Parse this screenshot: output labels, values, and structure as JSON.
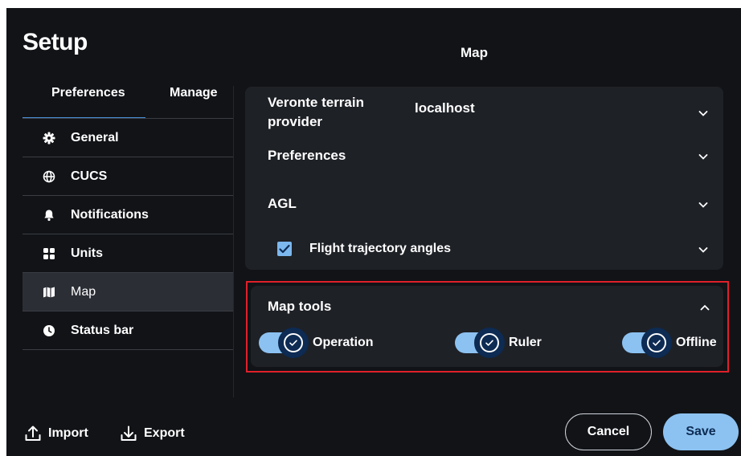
{
  "dialog": {
    "title": "Setup",
    "section_title": "Map"
  },
  "tabs": [
    {
      "label": "Preferences",
      "active": true
    },
    {
      "label": "Manage",
      "active": false
    }
  ],
  "menu": [
    {
      "label": "General",
      "icon": "gear-icon"
    },
    {
      "label": "CUCS",
      "icon": "globe-icon"
    },
    {
      "label": "Notifications",
      "icon": "bell-icon"
    },
    {
      "label": "Units",
      "icon": "grid-icon"
    },
    {
      "label": "Map",
      "icon": "map-icon",
      "active": true
    },
    {
      "label": "Status bar",
      "icon": "clock-icon"
    }
  ],
  "settings": {
    "terrain_provider_label": "Veronte terrain provider",
    "terrain_provider_value": "localhost",
    "preferences_label": "Preferences",
    "agl_label": "AGL",
    "flight_trajectory_label": "Flight trajectory angles",
    "flight_trajectory_checked": true
  },
  "map_tools": {
    "title": "Map tools",
    "toggles": [
      {
        "label": "Operation",
        "on": true
      },
      {
        "label": "Ruler",
        "on": true
      },
      {
        "label": "Offline",
        "on": true
      }
    ]
  },
  "footer": {
    "import_label": "Import",
    "export_label": "Export",
    "cancel_label": "Cancel",
    "save_label": "Save"
  },
  "colors": {
    "background": "#111317",
    "panel": "#1e2126",
    "accent": "#8cc2f1",
    "knob": "#0d2b53",
    "highlight": "#e0202a"
  }
}
